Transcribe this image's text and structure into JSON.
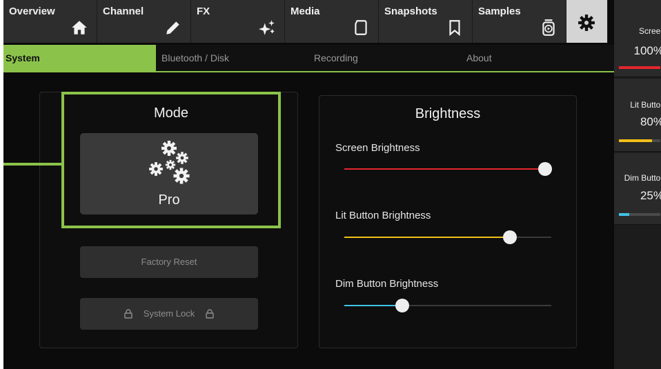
{
  "top_nav": {
    "tabs": [
      {
        "label": "Overview",
        "icon": "home-icon"
      },
      {
        "label": "Channel",
        "icon": "pencil-icon"
      },
      {
        "label": "FX",
        "icon": "sparkle-icon"
      },
      {
        "label": "Media",
        "icon": "sd-card-icon"
      },
      {
        "label": "Snapshots",
        "icon": "bookmark-icon"
      },
      {
        "label": "Samples",
        "icon": "sample-player-icon"
      }
    ],
    "settings_icon": "gear-icon"
  },
  "sub_nav": {
    "tabs": [
      "System",
      "Bluetooth / Disk",
      "Recording",
      "About"
    ],
    "active": "System"
  },
  "system": {
    "mode_title": "Mode",
    "mode_value": "Pro",
    "mode_icon": "gears-icon",
    "factory_reset": "Factory Reset",
    "system_lock": "System Lock"
  },
  "brightness": {
    "title": "Brightness",
    "sliders": [
      {
        "label": "Screen Brightness",
        "value": 0.97,
        "color": "#e5262d"
      },
      {
        "label": "Lit Button Brightness",
        "value": 0.8,
        "color": "#f2c019"
      },
      {
        "label": "Dim Button Brightness",
        "value": 0.28,
        "color": "#3fc3e6"
      }
    ]
  },
  "right_strip": [
    {
      "name": "Screen",
      "value": "100%",
      "level": 1.0,
      "color": "#e5262d"
    },
    {
      "name": "Lit Button",
      "value": "80%",
      "level": 0.8,
      "color": "#f2c019"
    },
    {
      "name": "Dim Button",
      "value": "25%",
      "level": 0.25,
      "color": "#3fc3e6"
    }
  ],
  "colors": {
    "accent": "#8bc34a",
    "panel_bg": "#0e0e0e",
    "tab_bg": "#2d2d2d"
  }
}
